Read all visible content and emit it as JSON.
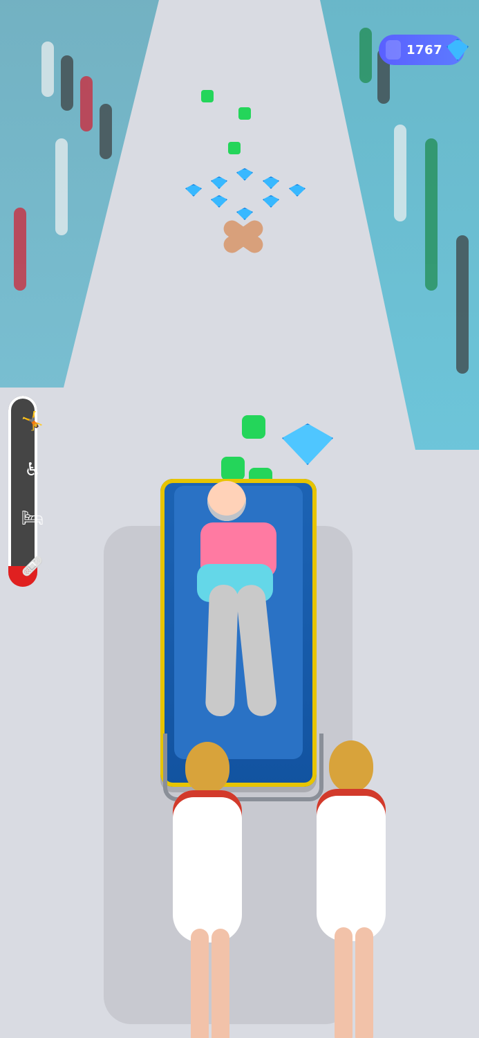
{
  "hud": {
    "gem_count": "1767"
  },
  "pain_meter": {
    "level_fraction": 0.11,
    "stage_icons": [
      "falling-person-icon",
      "wheelchair-icon",
      "injured-person-icon",
      "stretcher-icon"
    ]
  },
  "colors": {
    "hud_pill": "#5a60ff",
    "gem": "#38b8ff",
    "thumb": "#24d55a",
    "meter_fill": "#e02020"
  }
}
